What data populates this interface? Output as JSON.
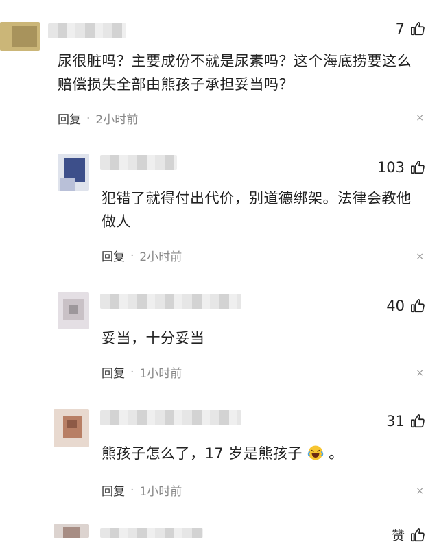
{
  "comments": [
    {
      "likes": "7",
      "text": "尿很脏吗？主要成份不就是尿素吗？这个海底捞要这么赔偿损失全部由熊孩子承担妥当吗？",
      "reply": "回复",
      "dot": "·",
      "time": "2小时前",
      "close": "×"
    },
    {
      "likes": "103",
      "text": "犯错了就得付出代价，别道德绑架。法律会教他做人",
      "reply": "回复",
      "dot": "·",
      "time": "2小时前",
      "close": "×"
    },
    {
      "likes": "40",
      "text": "妥当，十分妥当",
      "reply": "回复",
      "dot": "·",
      "time": "1小时前",
      "close": "×"
    },
    {
      "likes": "31",
      "text_before": "熊孩子怎么了，17 岁是熊孩子",
      "text_after": "。",
      "emoji": "laughing-crying-emoji",
      "reply": "回复",
      "dot": "·",
      "time": "1小时前",
      "close": "×"
    },
    {
      "likes_label": "赞"
    }
  ]
}
